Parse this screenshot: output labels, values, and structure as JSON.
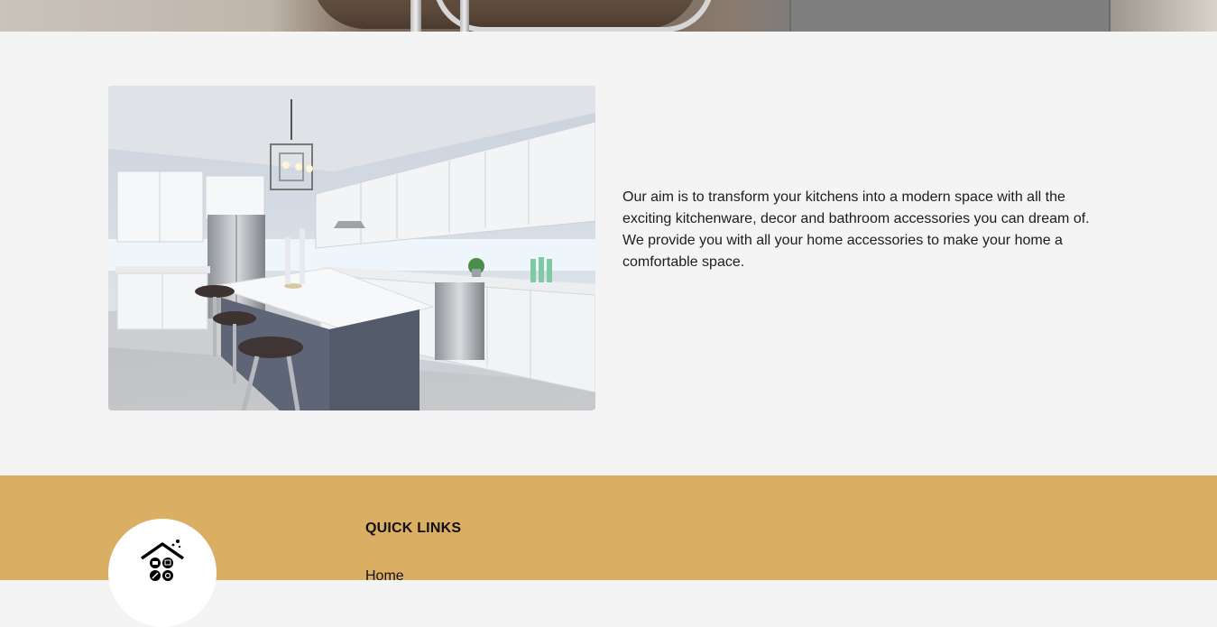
{
  "about": {
    "image_alt": "Modern white kitchen with island and bar stools",
    "description": "Our aim is to transform your kitchens into a modern space with all the exciting kitchenware, decor and bathroom accessories you can dream of. We provide you with all your home accessories to make your home a comfortable space."
  },
  "footer": {
    "logo_icon": "home-kitchen-logo-icon",
    "quick_links_heading": "QUICK LINKS",
    "links": [
      {
        "label": "Home"
      }
    ]
  },
  "colors": {
    "page_background": "#f4f4f4",
    "footer_background": "#dbaf63",
    "text": "#1c1c1c"
  }
}
